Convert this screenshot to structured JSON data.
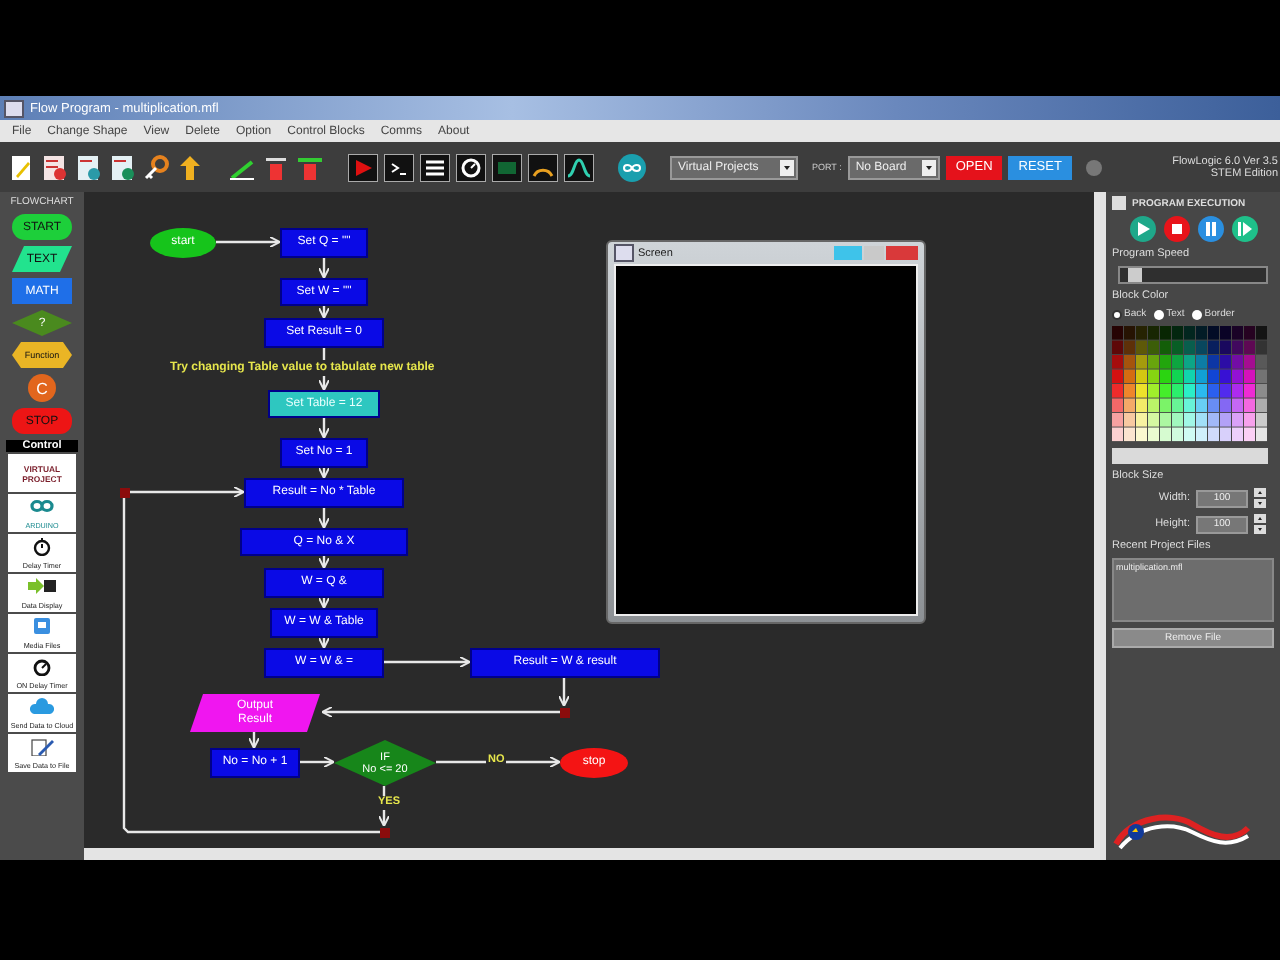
{
  "window": {
    "title": "Flow Program - multiplication.mfl"
  },
  "menu": [
    "File",
    "Change Shape",
    "View",
    "Delete",
    "Option",
    "Control Blocks",
    "Comms",
    "About"
  ],
  "toolbar": {
    "project_select": "Virtual Projects",
    "port_label": "PORT :",
    "port_select": "No Board",
    "open_button": "OPEN",
    "reset_button": "RESET",
    "version": "FlowLogic 6.0 Ver 3.5",
    "edition": "STEM Edition"
  },
  "palette": {
    "title": "FLOWCHART",
    "shapes": [
      {
        "kind": "start",
        "label": "START"
      },
      {
        "kind": "text",
        "label": "TEXT"
      },
      {
        "kind": "math",
        "label": "MATH"
      },
      {
        "kind": "decision",
        "label": "?"
      },
      {
        "kind": "function",
        "label": "Function"
      },
      {
        "kind": "connector",
        "label": "C"
      },
      {
        "kind": "stop",
        "label": "STOP"
      }
    ],
    "control_title": "Control",
    "controls": [
      {
        "kind": "virtual",
        "label": "VIRTUAL PROJECT"
      },
      {
        "kind": "arduino",
        "label": "ARDUINO"
      },
      {
        "kind": "delay",
        "label": "Delay Timer"
      },
      {
        "kind": "display",
        "label": "Data Display"
      },
      {
        "kind": "media",
        "label": "Media Files"
      },
      {
        "kind": "ondelay",
        "label": "ON Delay Timer"
      },
      {
        "kind": "cloud",
        "label": "Send Data to Cloud"
      },
      {
        "kind": "save",
        "label": "Save Data to File"
      }
    ]
  },
  "flowchart": {
    "nodes": [
      {
        "kind": "terminal_start",
        "lines": [
          "start"
        ]
      },
      {
        "kind": "process",
        "lines": [
          "Set Q = \"\""
        ]
      },
      {
        "kind": "process",
        "lines": [
          "Set W = \"\""
        ]
      },
      {
        "kind": "process",
        "lines": [
          "Set Result = 0"
        ]
      },
      {
        "kind": "note",
        "lines": [
          "Try changing Table value to tabulate new table"
        ]
      },
      {
        "kind": "process_highlight",
        "lines": [
          "Set Table = 12"
        ]
      },
      {
        "kind": "process",
        "lines": [
          "Set No = 1"
        ]
      },
      {
        "kind": "process",
        "lines": [
          "Result = No * Table"
        ]
      },
      {
        "kind": "process",
        "lines": [
          "Q = No &  X"
        ]
      },
      {
        "kind": "process",
        "lines": [
          "W = Q &"
        ]
      },
      {
        "kind": "process",
        "lines": [
          "W = W & Table"
        ]
      },
      {
        "kind": "process",
        "lines": [
          "W = W &  ="
        ]
      },
      {
        "kind": "process",
        "lines": [
          "Result = W & result"
        ]
      },
      {
        "kind": "output",
        "lines": [
          "Output",
          "Result"
        ]
      },
      {
        "kind": "process",
        "lines": [
          "No = No + 1"
        ]
      },
      {
        "kind": "decision",
        "lines": [
          "IF",
          "No <= 20"
        ]
      },
      {
        "kind": "label",
        "lines": [
          "NO"
        ]
      },
      {
        "kind": "terminal_stop",
        "lines": [
          "stop"
        ]
      },
      {
        "kind": "label",
        "lines": [
          "YES"
        ]
      }
    ]
  },
  "screen_window": {
    "title": "Screen"
  },
  "execution": {
    "title": "PROGRAM EXECUTION",
    "speed_label": "Program Speed",
    "speed_slider": {
      "level": 0.05
    },
    "block_color_label": "Block Color",
    "color_targets": [
      {
        "label": "Back",
        "selected": true
      },
      {
        "label": "Text",
        "selected": false
      },
      {
        "label": "Border",
        "selected": false
      }
    ],
    "block_size_label": "Block Size",
    "width_label": "Width:",
    "width_value": "100",
    "height_label": "Height:",
    "height_value": "100",
    "recent_label": "Recent Project Files",
    "recent_files": [
      "multiplication.mfl"
    ],
    "remove_button": "Remove File"
  }
}
